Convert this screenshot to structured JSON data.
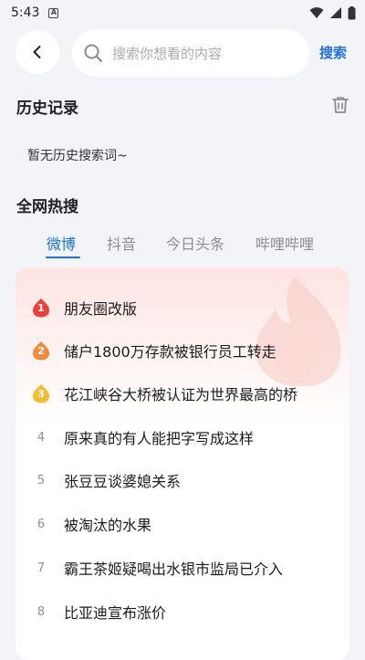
{
  "status_bar": {
    "time": "5:43",
    "notification_badge": "A"
  },
  "top_bar": {
    "search_placeholder": "搜索你想看的内容",
    "search_button": "搜索"
  },
  "history": {
    "title": "历史记录",
    "empty_text": "暂无历史搜索词~"
  },
  "hot": {
    "title": "全网热搜",
    "tabs": [
      {
        "label": "微博",
        "active": true
      },
      {
        "label": "抖音",
        "active": false
      },
      {
        "label": "今日头条",
        "active": false
      },
      {
        "label": "哔哩哔哩",
        "active": false
      }
    ],
    "items": [
      {
        "rank": "1",
        "text": "朋友圈改版"
      },
      {
        "rank": "2",
        "text": "储户1800万存款被银行员工转走"
      },
      {
        "rank": "3",
        "text": "花江峡谷大桥被认证为世界最高的桥"
      },
      {
        "rank": "4",
        "text": "原来真的有人能把字写成这样"
      },
      {
        "rank": "5",
        "text": "张豆豆谈婆媳关系"
      },
      {
        "rank": "6",
        "text": "被淘汰的水果"
      },
      {
        "rank": "7",
        "text": "霸王茶姬疑喝出水银市监局已介入"
      },
      {
        "rank": "8",
        "text": "比亚迪宣布涨价"
      }
    ]
  },
  "colors": {
    "accent": "#1f6fe0",
    "rank1": "#e8413c",
    "rank2": "#f08a3c",
    "rank3": "#f2bd33"
  },
  "icons": [
    "wifi-icon",
    "signal-icon",
    "battery-icon",
    "back-icon",
    "search-icon",
    "trash-icon",
    "flame-icon"
  ]
}
